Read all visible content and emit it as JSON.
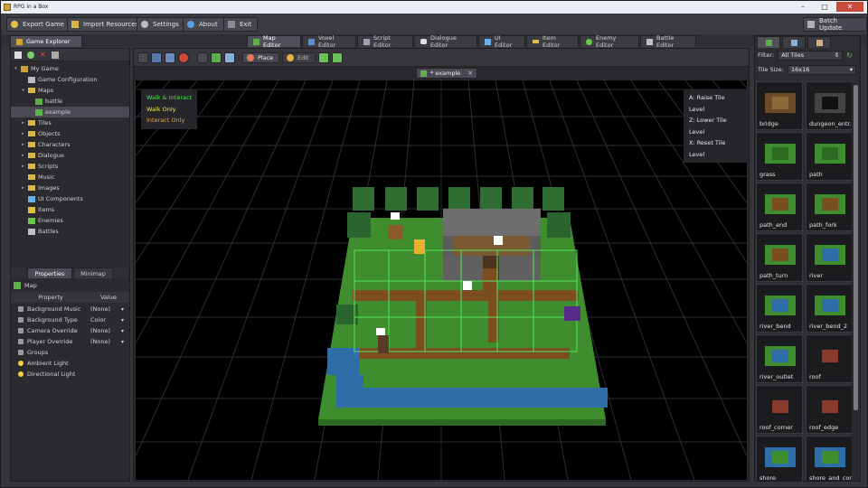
{
  "window": {
    "title": "RPG in a Box"
  },
  "toolbar": {
    "export_game": "Export Game",
    "import_resources": "Import Resources",
    "settings": "Settings",
    "about": "About",
    "exit": "Exit",
    "batch_update": "Batch Update"
  },
  "tabs": {
    "game_explorer": "Game Explorer",
    "editors": [
      "Map Editor",
      "Voxel Editor",
      "Script Editor",
      "Dialogue Editor",
      "UI Editor",
      "Item Editor",
      "Enemy Editor",
      "Battle Editor"
    ]
  },
  "explorer": {
    "items": [
      {
        "label": "My Game",
        "indent": 0,
        "arrow": "▾",
        "icon": "game-icon"
      },
      {
        "label": "Game Configuration",
        "indent": 1,
        "arrow": "",
        "icon": "gear-icon"
      },
      {
        "label": "Maps",
        "indent": 1,
        "arrow": "▾",
        "icon": "folder-icon"
      },
      {
        "label": "battle",
        "indent": 2,
        "arrow": "",
        "icon": "map-icon"
      },
      {
        "label": "example",
        "indent": 2,
        "arrow": "",
        "icon": "map-icon",
        "selected": true
      },
      {
        "label": "Tiles",
        "indent": 1,
        "arrow": "▸",
        "icon": "folder-icon"
      },
      {
        "label": "Objects",
        "indent": 1,
        "arrow": "▸",
        "icon": "folder-icon"
      },
      {
        "label": "Characters",
        "indent": 1,
        "arrow": "▸",
        "icon": "folder-icon"
      },
      {
        "label": "Dialogue",
        "indent": 1,
        "arrow": "▸",
        "icon": "folder-icon"
      },
      {
        "label": "Scripts",
        "indent": 1,
        "arrow": "▸",
        "icon": "folder-icon"
      },
      {
        "label": "Music",
        "indent": 1,
        "arrow": "",
        "icon": "folder-icon"
      },
      {
        "label": "Images",
        "indent": 1,
        "arrow": "▸",
        "icon": "folder-icon"
      },
      {
        "label": "UI Components",
        "indent": 1,
        "arrow": "",
        "icon": "ui-icon"
      },
      {
        "label": "Items",
        "indent": 1,
        "arrow": "",
        "icon": "item-icon"
      },
      {
        "label": "Enemies",
        "indent": 1,
        "arrow": "",
        "icon": "enemy-icon"
      },
      {
        "label": "Battles",
        "indent": 1,
        "arrow": "",
        "icon": "battle-icon"
      }
    ]
  },
  "properties": {
    "tabs": [
      "Properties",
      "Minimap"
    ],
    "section": "Map",
    "header_property": "Property",
    "header_value": "Value",
    "rows": [
      {
        "name": "Background Music",
        "value": "(None)"
      },
      {
        "name": "Background Type",
        "value": "Color"
      },
      {
        "name": "Camera Override",
        "value": "(None)"
      },
      {
        "name": "Player Override",
        "value": "(None)"
      },
      {
        "name": "Groups",
        "value": ""
      },
      {
        "name": "Ambient Light",
        "value": ""
      },
      {
        "name": "Directional Light",
        "value": ""
      }
    ]
  },
  "map_toolbar": {
    "place": "Place",
    "edit": "Edit",
    "document_tab": "* example"
  },
  "legend_left": {
    "walk_interact": "Walk & Interact",
    "walk_only": "Walk Only",
    "interact_only": "Interact Only",
    "colors": {
      "walk_interact": "#4fe34f",
      "walk_only": "#f0e84a",
      "interact_only": "#f0a03a"
    }
  },
  "legend_right": {
    "raise": "A: Raise Tile Level",
    "lower": "Z: Lower Tile Level",
    "reset": "X: Reset Tile Level"
  },
  "tiles_panel": {
    "filter_label": "Filter:",
    "filter_value": "All Tiles",
    "size_label": "Tile Size:",
    "size_value": "16x16",
    "tiles": [
      {
        "name": "bridge",
        "kind": "bridge"
      },
      {
        "name": "dungeon_entr...",
        "kind": "dungeon"
      },
      {
        "name": "grass",
        "kind": "grass"
      },
      {
        "name": "path",
        "kind": "grass"
      },
      {
        "name": "path_end",
        "kind": "path"
      },
      {
        "name": "path_fork",
        "kind": "path"
      },
      {
        "name": "path_turn",
        "kind": "path"
      },
      {
        "name": "river",
        "kind": "river"
      },
      {
        "name": "river_bend",
        "kind": "river"
      },
      {
        "name": "river_bend_2",
        "kind": "river"
      },
      {
        "name": "river_outlet",
        "kind": "river"
      },
      {
        "name": "roof",
        "kind": "roof"
      },
      {
        "name": "roof_corner",
        "kind": "roof"
      },
      {
        "name": "roof_edge",
        "kind": "roof"
      },
      {
        "name": "shore",
        "kind": "shore"
      },
      {
        "name": "shore_and_cor...",
        "kind": "shore"
      }
    ]
  }
}
